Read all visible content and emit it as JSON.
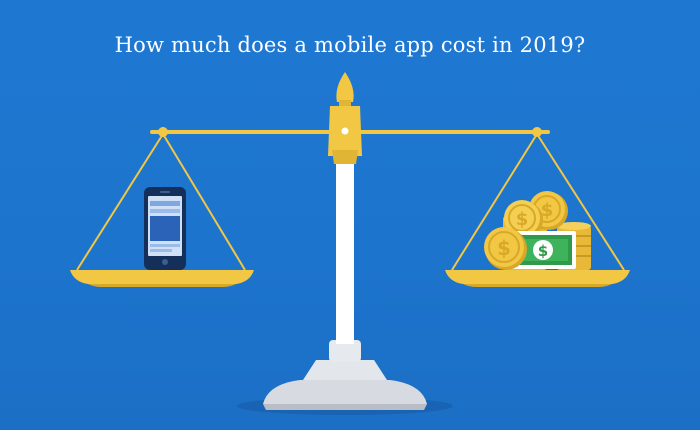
{
  "headline": "How much does a mobile app cost in 2019?",
  "icons": {
    "balance_scale": "balance-scale-icon",
    "smartphone": "smartphone-icon",
    "coins": "coin-stack-icon",
    "banknote": "dollar-bill-icon",
    "currency_symbol": "$"
  },
  "colors": {
    "background": "#1e78d2",
    "gold": "#f2c744",
    "gold_dark": "#d8a828",
    "pillar": "#ffffff",
    "base": "#d9dde2",
    "phone_frame": "#14305a",
    "phone_screen": "#cfe0f7",
    "bill_green": "#2e9a4a"
  }
}
